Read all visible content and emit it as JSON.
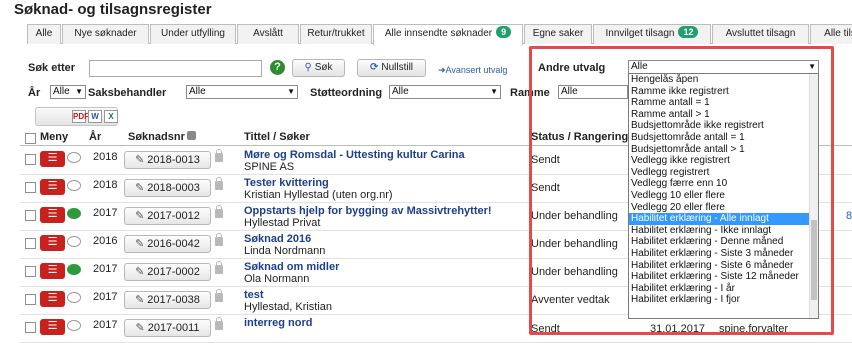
{
  "app": {
    "title": "Søknad- og tilsagnsregister"
  },
  "tabs": [
    {
      "label": "Alle"
    },
    {
      "label": "Nye søknader"
    },
    {
      "label": "Under utfylling"
    },
    {
      "label": "Avslått"
    },
    {
      "label": "Retur/trukket"
    },
    {
      "label": "Alle innsendte søknader",
      "badge": "9"
    },
    {
      "label": "Egne saker"
    },
    {
      "label": "Innvilget tilsagn",
      "badge": "12"
    },
    {
      "label": "Avsluttet tilsagn"
    },
    {
      "label": "Alle tils"
    }
  ],
  "search": {
    "label": "Søk etter",
    "value": "",
    "help": "?",
    "search_button": "Søk",
    "reset_button": "Nullstill",
    "advanced_link": "Avansert utvalg"
  },
  "filters": {
    "andre_utvalg_label": "Andre utvalg",
    "andre_utvalg_value": "Alle",
    "year_label": "År",
    "year_value": "Alle",
    "caseworker_label": "Saksbehandler",
    "caseworker_value": "Alle",
    "scheme_label": "Støtteordning",
    "scheme_value": "Alle",
    "frame_label": "Ramme",
    "frame_value": "Alle"
  },
  "dropdown_options": [
    "Hengelås åpen",
    "Ramme ikke registrert",
    "Ramme antall = 1",
    "Ramme antall > 1",
    "Budsjettområde ikke registrert",
    "Budsjettområde antall = 1",
    "Budsjettområde antall > 1",
    "Vedlegg ikke registrert",
    "Vedlegg registrert",
    "Vedlegg færre enn 10",
    "Vedlegg 10 eller flere",
    "Vedlegg 20 eller flere",
    "Habilitet erklæring - Alle innlagt",
    "Habilitet erklæring - Ikke innlagt",
    "Habilitet erklæring - Denne måned",
    "Habilitet erklæring - Siste 3 måneder",
    "Habilitet erklæring - Siste 6 måneder",
    "Habilitet erklæring - Siste 12 måneder",
    "Habilitet erklæring - I år",
    "Habilitet erklæring - I fjor"
  ],
  "dropdown_selected_index": 12,
  "table": {
    "headers": {
      "menu": "Meny",
      "year": "År",
      "number": "Søknadsnr",
      "title": "Tittel",
      "applicant": "/ Søker",
      "status": "Status / Rangering"
    },
    "rows": [
      {
        "year": "2018",
        "number": "2018-0013",
        "title": "Møre og Romsdal - Uttesting kultur Carina",
        "applicant": "SPINE AS",
        "status": "Sendt",
        "comment": "empty",
        "edge": ""
      },
      {
        "year": "2018",
        "number": "2018-0003",
        "title": "Tester kvittering",
        "applicant": "Kristian Hyllestad (uten org.nr)",
        "status": "Sendt",
        "comment": "empty",
        "edge": ""
      },
      {
        "year": "2017",
        "number": "2017-0012",
        "title": "Oppstarts hjelp for bygging av Massivtrehytter!",
        "applicant": "Hyllestad Privat",
        "status": "Under behandling",
        "comment": "filled",
        "edge": "8"
      },
      {
        "year": "2016",
        "number": "2016-0042",
        "title": "Søknad 2016",
        "applicant": "Linda Nordmann",
        "status": "Under behandling",
        "comment": "empty",
        "edge": ""
      },
      {
        "year": "2017",
        "number": "2017-0002",
        "title": "Søknad om midler",
        "applicant": "Ola Normann",
        "status": "Under behandling",
        "comment": "filled",
        "edge": ""
      },
      {
        "year": "2017",
        "number": "2017-0038",
        "title": "test",
        "applicant": "Hyllestad, Kristian",
        "status": "Avventer vedtak",
        "comment": "empty",
        "edge": ""
      },
      {
        "year": "2017",
        "number": "2017-0011",
        "title": "interreg nord",
        "applicant": "",
        "status": "Sendt",
        "comment": "empty",
        "edge": "",
        "date": "31.01.2017",
        "user": "spine.forvalter"
      }
    ]
  },
  "colors": {
    "accent_red": "#c9211e",
    "highlight_red": "#e34a4a",
    "badge_green": "#1f9e6e",
    "title_blue": "#1d3f8a",
    "selected_blue": "#3399ff"
  },
  "icons": {
    "help": "help-icon",
    "search": "search-icon",
    "reset": "refresh-icon",
    "pdf": "pdf-export-icon",
    "word": "word-export-icon",
    "excel": "excel-export-icon"
  }
}
